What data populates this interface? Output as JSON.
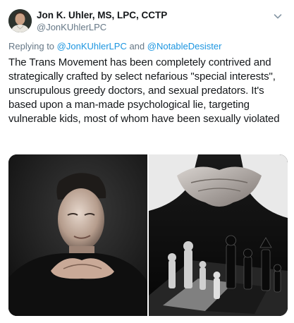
{
  "author": {
    "display_name": "Jon K. Uhler, MS, LPC, CCTP",
    "handle": "@JonKUhlerLPC"
  },
  "reply": {
    "prefix": "Replying to ",
    "mention_1": "@JonKUhlerLPC",
    "conjunction": " and ",
    "mention_2": "@NotableDesister"
  },
  "tweet": {
    "text": "The Trans Movement has been completely contrived and strategically crafted by select nefarious \"special interests\", unscrupulous greedy doctors, and sexual predators. It's based upon a man-made psychological lie, targeting vulnerable kids, most of whom have been sexually violated"
  },
  "colors": {
    "link": "#1b95e0",
    "secondary_text": "#657786",
    "primary_text": "#14171a"
  },
  "icons": {
    "menu": "chevron-down-icon"
  }
}
